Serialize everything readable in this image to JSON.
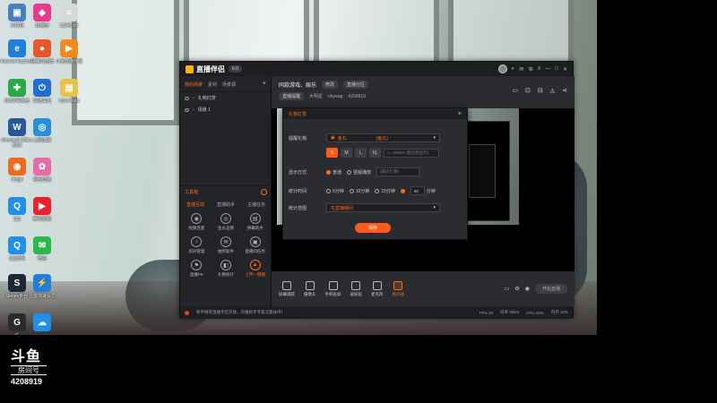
{
  "desktop_icons": [
    {
      "label": "计算机",
      "color": "#4a7fbf",
      "glyph": "▣"
    },
    {
      "label": "猿畅游",
      "color": "#e63a8a",
      "glyph": "◆"
    },
    {
      "label": "12345.txt",
      "color": "#d8d8d8",
      "glyph": "≡"
    },
    {
      "label": "Internet Explorer",
      "color": "#1f7fd8",
      "glyph": "e"
    },
    {
      "label": "极速浏览器",
      "color": "#e8562e",
      "glyph": "●"
    },
    {
      "label": "斗鱼直播伴侣",
      "color": "#f08a1c",
      "glyph": "▶"
    },
    {
      "label": "360杀毒安全",
      "color": "#2aa84a",
      "glyph": "✚"
    },
    {
      "label": "快捷关机",
      "color": "#1f6fd0",
      "glyph": "⏻"
    },
    {
      "label": "User Data",
      "color": "#e8c24a",
      "glyph": "▤"
    },
    {
      "label": "Microsoft Office 2007",
      "color": "#2b5797",
      "glyph": "W"
    },
    {
      "label": "上网加速",
      "color": "#2a8fd8",
      "glyph": "◎"
    },
    {
      "label": "Origin",
      "color": "#f06a1c",
      "glyph": "◉"
    },
    {
      "label": "简约壁纸",
      "color": "#e86aa8",
      "glyph": "✿"
    },
    {
      "label": "QQ",
      "color": "#1f8fe8",
      "glyph": "Q"
    },
    {
      "label": "腾讯视频",
      "color": "#e8232e",
      "glyph": "▶"
    },
    {
      "label": "QQ游戏",
      "color": "#1f8fe8",
      "glyph": "Q"
    },
    {
      "label": "微信",
      "color": "#2ab84a",
      "glyph": "✉"
    },
    {
      "label": "Steam平台",
      "color": "#1b2838",
      "glyph": "S"
    },
    {
      "label": "迅雷加速会员",
      "color": "#1f7fd8",
      "glyph": "⚡"
    },
    {
      "label": "G",
      "color": "#2b2b2b",
      "glyph": "G"
    },
    {
      "label": "",
      "color": "#1f8fe8",
      "glyph": "☁"
    }
  ],
  "watermark": {
    "logo": "斗鱼",
    "sub": "房间号",
    "room": "4208919"
  },
  "app": {
    "name": "直播伴侣",
    "version": "6.0",
    "title_icons": [
      "min",
      "max",
      "close"
    ],
    "left_tabs": [
      "我的场景",
      "素材",
      "场景源"
    ],
    "active_left_tab": "我的场景",
    "scenes": [
      "礼物打赏",
      "场景 1"
    ],
    "tools_label": "工具箱",
    "tools_tabs": [
      "直播互动",
      "直播助手",
      "主播任务"
    ],
    "tools": [
      {
        "label": "视频连麦",
        "hot": false
      },
      {
        "label": "鱼丸竞猜",
        "hot": false
      },
      {
        "label": "弹幕助手",
        "hot": false
      },
      {
        "label": "房间管理",
        "hot": false
      },
      {
        "label": "抽奖助手",
        "hot": false
      },
      {
        "label": "直播间任务",
        "hot": false
      },
      {
        "label": "直播PK",
        "hot": false
      },
      {
        "label": "礼物统计",
        "hot": false
      },
      {
        "label": "上传一键播",
        "hot": true
      }
    ],
    "stream_title": "同款游戏、娱乐",
    "stream_chips": [
      "修改",
      "直播分区"
    ],
    "stream_meta": [
      "直播提醒",
      "大明星",
      "ohyeap",
      "4208919"
    ],
    "bottom_tools": [
      {
        "label": "屏幕捕获",
        "hot": false
      },
      {
        "label": "摄像头",
        "hot": false
      },
      {
        "label": "手机投屏",
        "hot": false
      },
      {
        "label": "录屏投",
        "hot": false
      },
      {
        "label": "麦克风",
        "hot": false
      },
      {
        "label": "扬声器",
        "hot": true
      }
    ],
    "start_button": "开始直播",
    "status": [
      "和平精英直播专区开放，开播即享专属流量扶持！",
      "FPS 30",
      "码率 0kb/s",
      "CPU 20%",
      "内存 10%"
    ]
  },
  "dialog": {
    "title": "礼物打赏",
    "close": "×",
    "row1_label": "提醒礼物",
    "row1_value": "鱼丸",
    "row1_extra": "(鱼丸)",
    "row2_label": "礼物价格",
    "row2_sizes": [
      "S",
      "M",
      "L",
      "XL"
    ],
    "row2_placeholder": "1—99999 (超出后显示)",
    "row3_label": "显示方式",
    "row3_options": [
      "普通",
      "竖版播放"
    ],
    "row3_placeholder": "(最近礼物)",
    "row4_label": "统计时间",
    "row4_options": [
      "5分钟",
      "10分钟",
      "15分钟"
    ],
    "row4_value": "60",
    "row4_unit": "分钟",
    "row5_label": "统计范围",
    "row5_value": "在直播期间",
    "confirm": "保存"
  }
}
